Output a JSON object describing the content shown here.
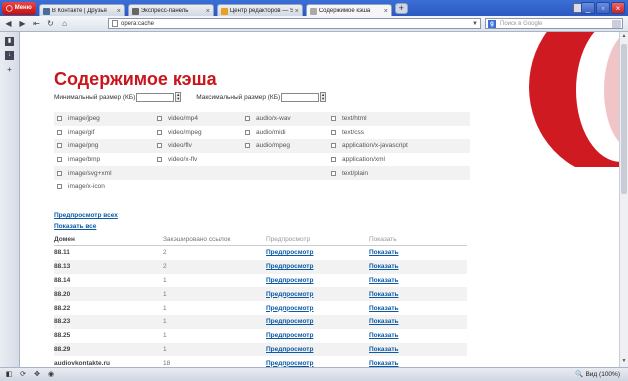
{
  "browser": {
    "menu_label": "Меню",
    "tabs": [
      {
        "label": "В Контакте | Друзья",
        "color": "#4a6e9b"
      },
      {
        "label": "Экспресс-панель",
        "color": "#666666"
      },
      {
        "label": "Центр редакторов — S...",
        "color": "#e8a020"
      },
      {
        "label": "Содержимое кэша",
        "color": "#aaaaaa"
      }
    ],
    "new_tab": "+",
    "address": "opera:cache",
    "search_placeholder": "Поиск в Google",
    "zoom": "Вид (100%)"
  },
  "page": {
    "title": "Содержимое кэша",
    "min_size_label": "Минимальный размер (КБ)",
    "max_size_label": "Максимальный размер (КБ)",
    "min_size_value": "",
    "max_size_value": ""
  },
  "types": [
    [
      "image/jpeg",
      "video/mp4",
      "audio/x-wav",
      "text/html"
    ],
    [
      "image/gif",
      "video/mpeg",
      "audio/midi",
      "text/css"
    ],
    [
      "image/png",
      "video/flv",
      "audio/mpeg",
      "application/x-javascript"
    ],
    [
      "image/bmp",
      "video/x-flv",
      "",
      "application/xml"
    ],
    [
      "image/svg+xml",
      "",
      "",
      "text/plain"
    ],
    [
      "image/x-icon",
      "",
      "",
      ""
    ]
  ],
  "links": {
    "preview_all": "Предпросмотр всех",
    "show_all": "Показать все"
  },
  "table": {
    "headers": [
      "Домен",
      "Закэшировано ссылок",
      "Предпросмотр",
      "Показать"
    ],
    "rows": [
      {
        "domain": "88.11",
        "count": "2",
        "preview": "Предпросмотр",
        "show": "Показать"
      },
      {
        "domain": "88.13",
        "count": "2",
        "preview": "Предпросмотр",
        "show": "Показать"
      },
      {
        "domain": "88.14",
        "count": "1",
        "preview": "Предпросмотр",
        "show": "Показать"
      },
      {
        "domain": "88.20",
        "count": "1",
        "preview": "Предпросмотр",
        "show": "Показать"
      },
      {
        "domain": "88.22",
        "count": "1",
        "preview": "Предпросмотр",
        "show": "Показать"
      },
      {
        "domain": "88.23",
        "count": "1",
        "preview": "Предпросмотр",
        "show": "Показать"
      },
      {
        "domain": "88.25",
        "count": "1",
        "preview": "Предпросмотр",
        "show": "Показать"
      },
      {
        "domain": "88.29",
        "count": "1",
        "preview": "Предпросмотр",
        "show": "Показать"
      },
      {
        "domain": "audiovkontakte.ru",
        "count": "18",
        "preview": "Предпросмотр",
        "show": "Показать"
      }
    ]
  },
  "colors": {
    "accent": "#c8161c",
    "link": "#0b5aa6"
  }
}
